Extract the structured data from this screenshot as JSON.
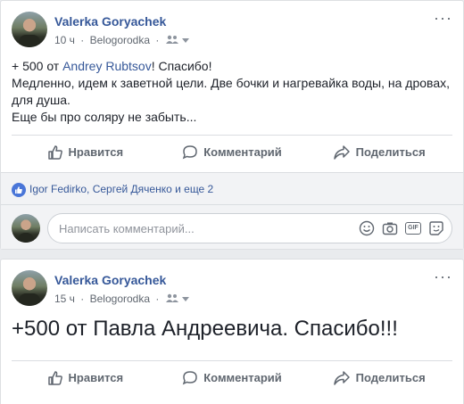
{
  "post1": {
    "author": "Valerka Goryachek",
    "time": "10 ч",
    "separator": "·",
    "location": "Belogorodka",
    "text_prefix": "+ 500 от ",
    "text_link": "Andrey Rubtsov",
    "text_suffix": "! Спасибо!",
    "line2": "Медленно, идем к заветной цели. Две бочки и нагревайка воды, на дровах,",
    "line3": "для душа.",
    "line4": "Еще бы про соляру не забыть...",
    "reactions_text": "Igor Fedirko, Сергей Дяченко и еще 2",
    "comment_placeholder": "Написать комментарий..."
  },
  "post2": {
    "author": "Valerka Goryachek",
    "time": "15 ч",
    "separator": "·",
    "location": "Belogorodka",
    "text": "+500 от Павла Андреевича. Спасибо!!!"
  },
  "actions": {
    "like": "Нравится",
    "comment": "Комментарий",
    "share": "Поделиться"
  },
  "icons": [
    "more-icon",
    "friends-audience-icon",
    "chevron-down-icon",
    "like-icon",
    "comment-icon",
    "share-icon",
    "smile-icon",
    "camera-icon",
    "gif-icon",
    "sticker-icon"
  ],
  "colors": {
    "link": "#365899",
    "muted": "#606770",
    "page_bg": "#e9ebee"
  }
}
